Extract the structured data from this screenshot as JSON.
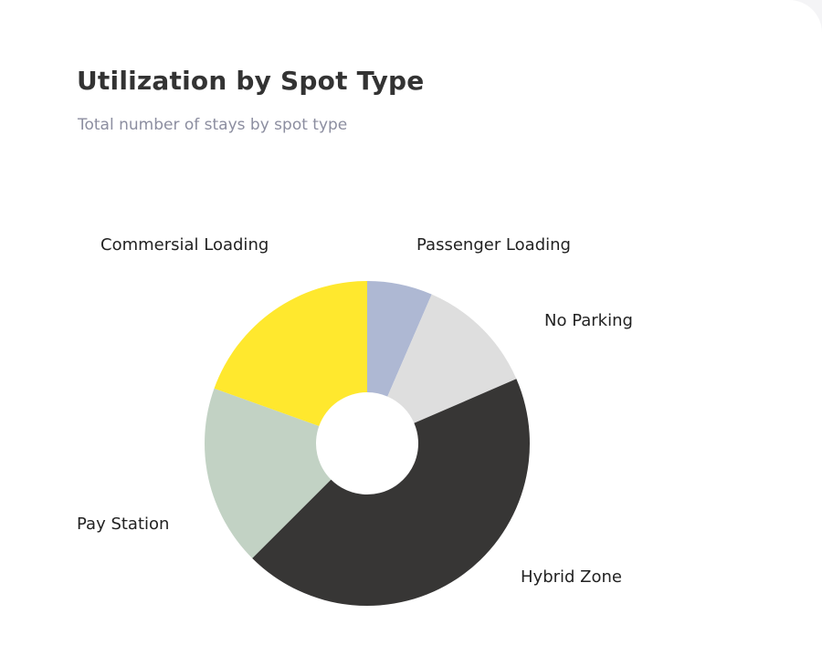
{
  "card": {
    "title": "Utilization by Spot Type",
    "subtitle": "Total number of stays by spot type"
  },
  "chart_data": {
    "type": "pie",
    "donut": true,
    "title": "Utilization by Spot Type",
    "subtitle": "Total number of stays by spot type",
    "legend": "none (slice labels placed outside)",
    "slices": [
      {
        "label": "Passenger Loading",
        "value": 6.5,
        "color": "#aeb8d3"
      },
      {
        "label": "No Parking",
        "value": 12,
        "color": "#dedede"
      },
      {
        "label": "Hybrid Zone",
        "value": 44,
        "color": "#373635"
      },
      {
        "label": "Pay Station",
        "value": 18,
        "color": "#c2d2c4"
      },
      {
        "label": "Commersial Loading",
        "value": 19.5,
        "color": "#ffe82e"
      }
    ]
  }
}
